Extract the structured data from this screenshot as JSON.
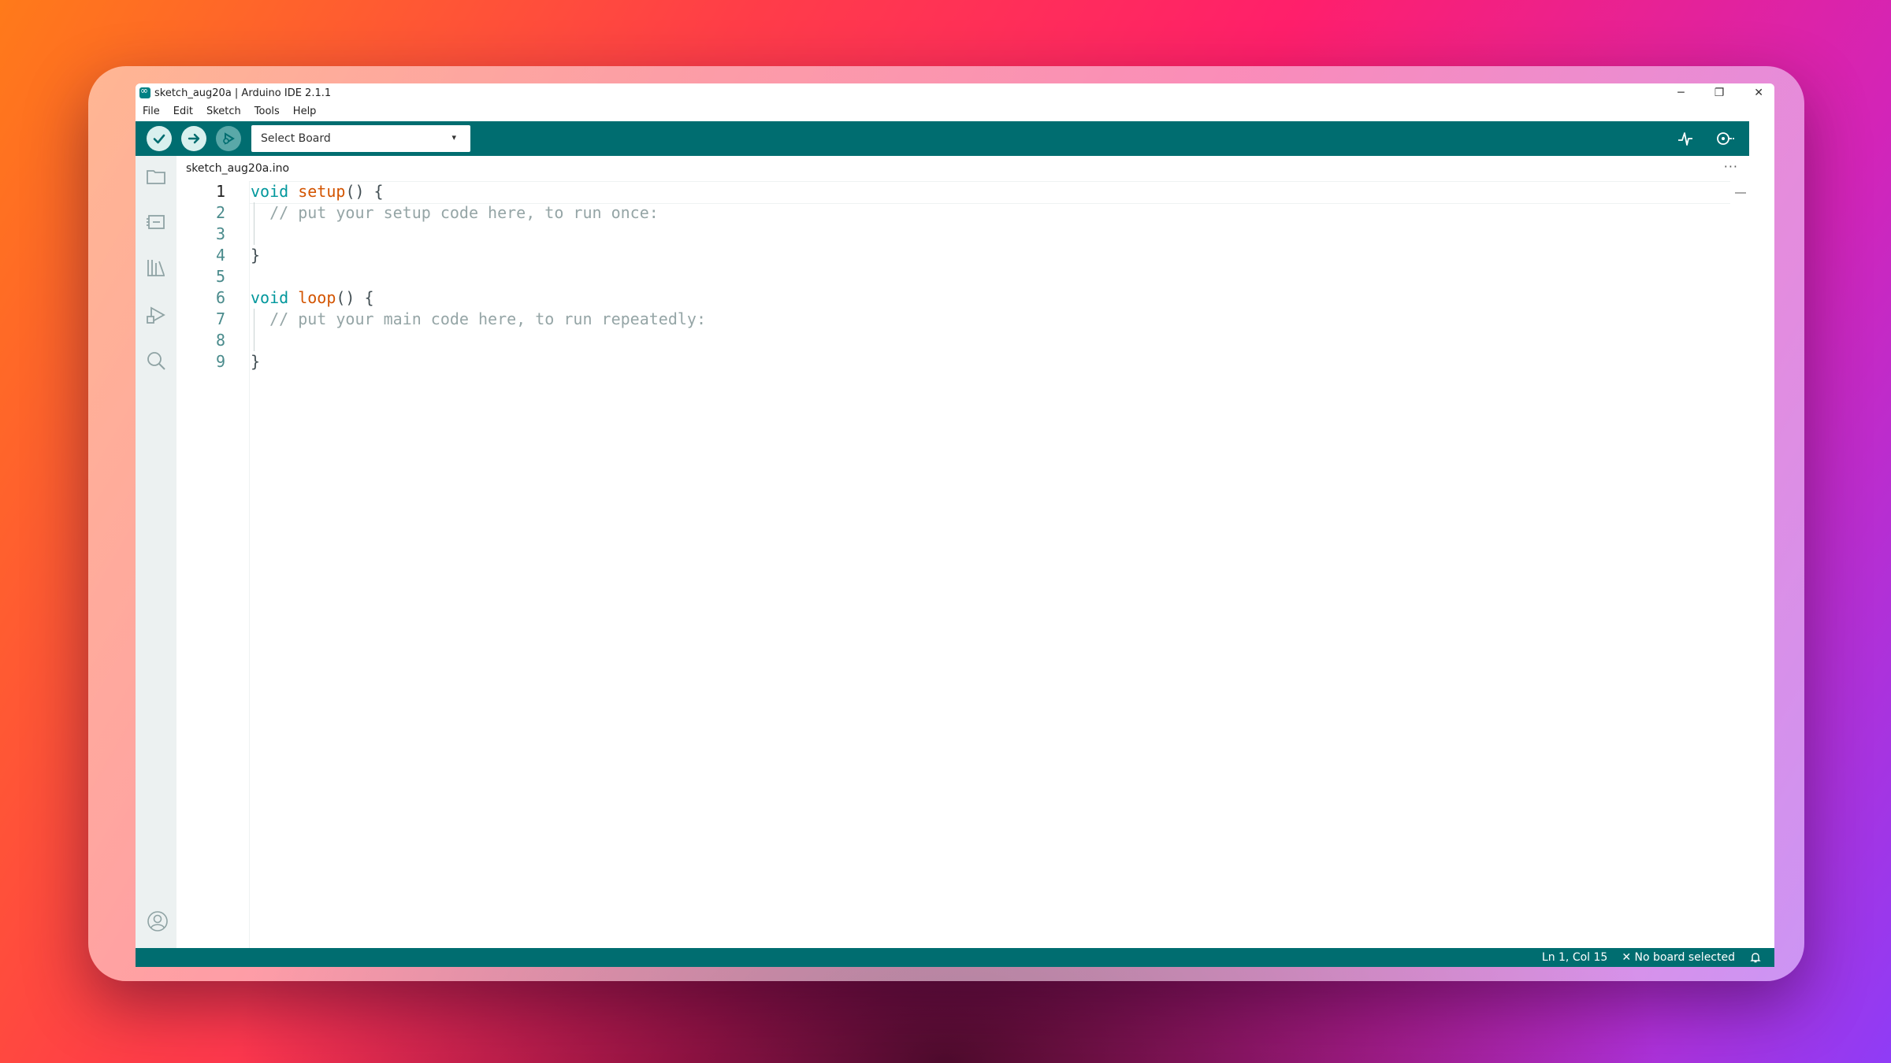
{
  "window": {
    "title": "sketch_aug20a | Arduino IDE 2.1.1",
    "controls": {
      "minimize": "─",
      "restore": "❐",
      "close": "✕"
    }
  },
  "menu": [
    "File",
    "Edit",
    "Sketch",
    "Tools",
    "Help"
  ],
  "toolbar": {
    "verify_icon": "check-icon",
    "upload_icon": "arrow-right-icon",
    "debug_icon": "debug-icon",
    "board_select": {
      "value": "Select Board",
      "caret": "▾"
    },
    "serial_plotter_icon": "plotter-icon",
    "serial_monitor_icon": "monitor-icon"
  },
  "sidebar": [
    "folder-icon",
    "board-manager-icon",
    "library-icon",
    "debug-icon",
    "search-icon"
  ],
  "tab": {
    "label": "sketch_aug20a.ino",
    "more": "···"
  },
  "editor": {
    "lines": [
      {
        "n": "1",
        "tokens": [
          {
            "t": "kw",
            "v": "void"
          },
          {
            "t": "p",
            "v": " "
          },
          {
            "t": "fn",
            "v": "setup"
          },
          {
            "t": "p",
            "v": "() {"
          }
        ]
      },
      {
        "n": "2",
        "tokens": [
          {
            "t": "p",
            "v": "  "
          },
          {
            "t": "cm",
            "v": "// put your setup code here, to run once:"
          }
        ]
      },
      {
        "n": "3",
        "tokens": []
      },
      {
        "n": "4",
        "tokens": [
          {
            "t": "p",
            "v": "}"
          }
        ]
      },
      {
        "n": "5",
        "tokens": []
      },
      {
        "n": "6",
        "tokens": [
          {
            "t": "kw",
            "v": "void"
          },
          {
            "t": "p",
            "v": " "
          },
          {
            "t": "fn",
            "v": "loop"
          },
          {
            "t": "p",
            "v": "() {"
          }
        ]
      },
      {
        "n": "7",
        "tokens": [
          {
            "t": "p",
            "v": "  "
          },
          {
            "t": "cm",
            "v": "// put your main code here, to run repeatedly:"
          }
        ]
      },
      {
        "n": "8",
        "tokens": []
      },
      {
        "n": "9",
        "tokens": [
          {
            "t": "p",
            "v": "}"
          }
        ]
      }
    ]
  },
  "statusbar": {
    "position": "Ln 1, Col 15",
    "board": "✕ No board selected",
    "bell_icon": "bell-icon"
  },
  "colors": {
    "teal": "#006d70",
    "keyword": "#00979c",
    "function": "#d35400",
    "comment": "#95a5a6"
  }
}
